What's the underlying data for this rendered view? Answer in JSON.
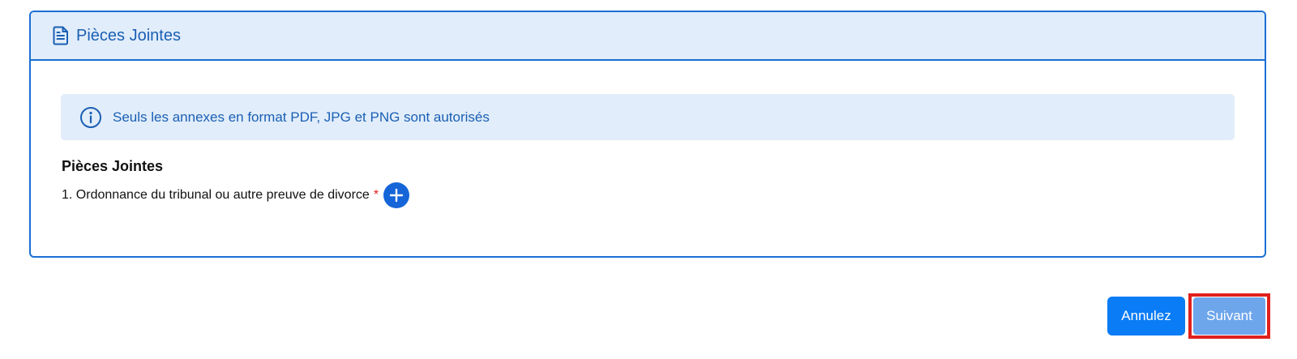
{
  "card": {
    "title": "Pièces Jointes",
    "icon": "document-icon"
  },
  "info": {
    "icon": "info-circle-icon",
    "text": "Seuls les annexes en format PDF, JPG et PNG sont autorisés"
  },
  "attachments": {
    "section_title": "Pièces Jointes",
    "items": [
      {
        "label": "1. Ordonnance du tribunal ou autre preuve de divorce",
        "required_mark": "*",
        "add_icon": "plus-circle-icon"
      }
    ]
  },
  "actions": {
    "cancel_label": "Annulez",
    "next_label": "Suivant"
  },
  "colors": {
    "primary": "#1a6fd4",
    "header_bg": "#e1edfa",
    "cancel_bg": "#0a7cf5",
    "next_bg": "#6ea6ec",
    "required": "#e0201b",
    "highlight_border": "#e0201b"
  }
}
